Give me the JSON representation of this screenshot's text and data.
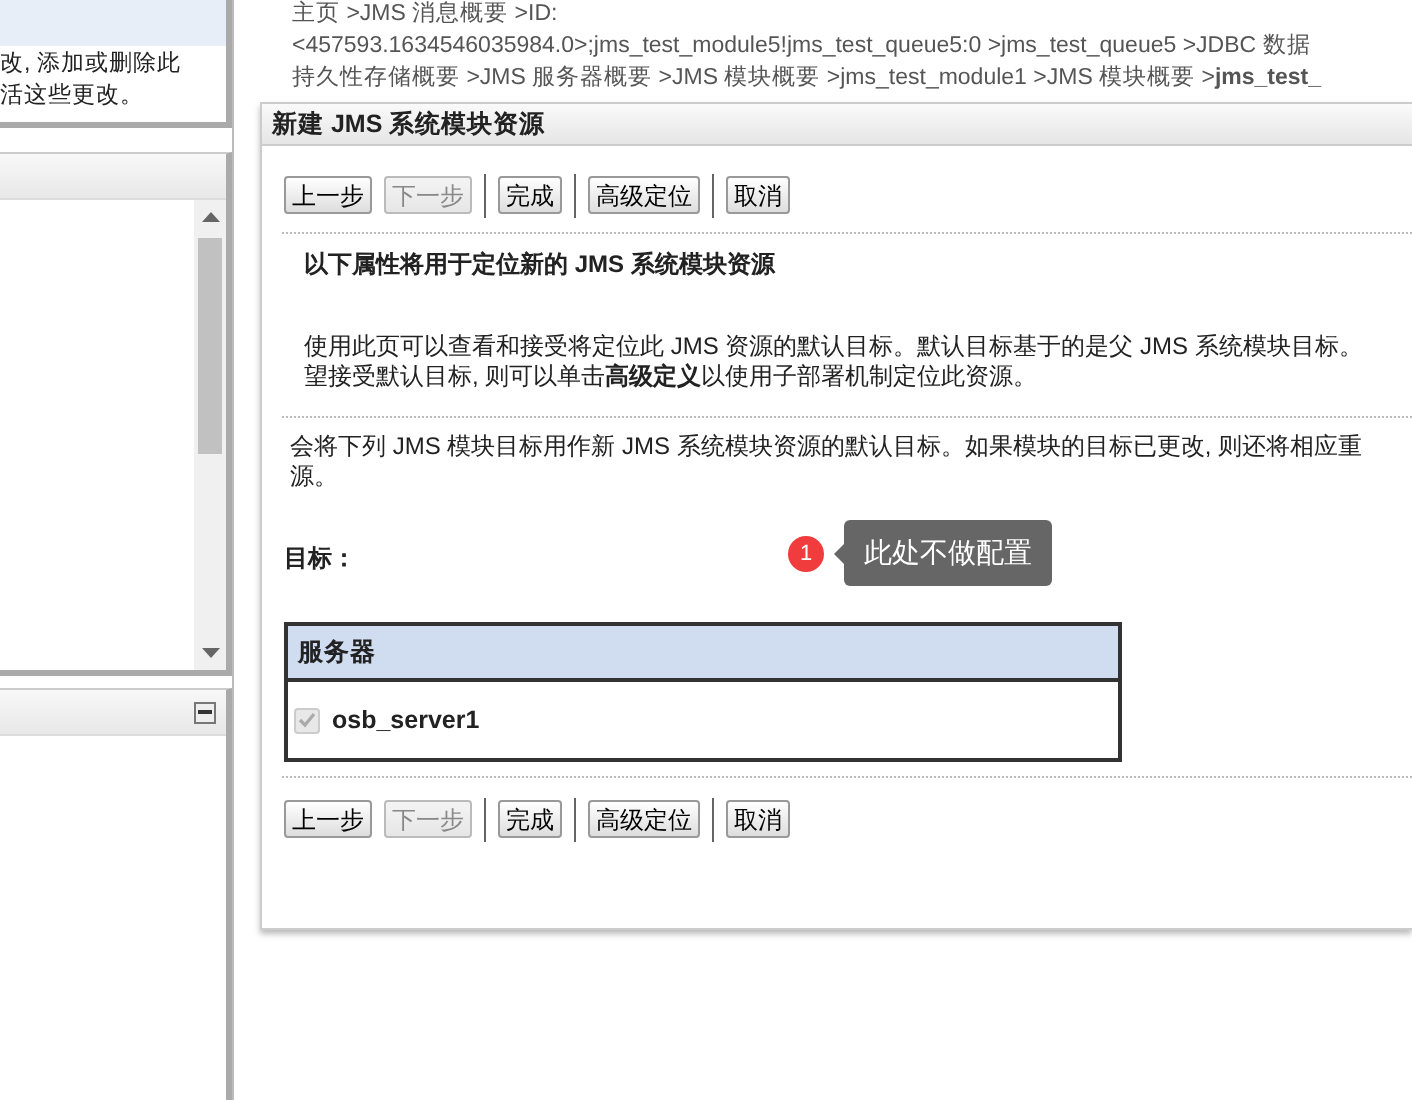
{
  "sidebar": {
    "change_center_lines": [
      "改, 添加或删除此",
      "活这些更改。"
    ],
    "panels": [
      {
        "kind": "scroll"
      },
      {
        "kind": "collapsible",
        "collapsed": false
      }
    ]
  },
  "breadcrumb": {
    "lines": [
      "主页 >JMS 消息概要 >ID:",
      "<457593.1634546035984.0>;jms_test_module5!jms_test_queue5:0 >jms_test_queue5 >JDBC 数据",
      "持久性存储概要 >JMS 服务器概要 >JMS 模块概要 >jms_test_module1 >JMS 模块概要 >**jms_test_**"
    ]
  },
  "panel": {
    "title": "新建 JMS 系统模块资源",
    "toolbar_top": [
      [
        {
          "label": "上一步",
          "disabled": false
        },
        {
          "label": "下一步",
          "disabled": true
        }
      ],
      [
        {
          "label": "完成",
          "disabled": false
        }
      ],
      [
        {
          "label": "高级定位",
          "disabled": false
        }
      ],
      [
        {
          "label": "取消",
          "disabled": false
        }
      ]
    ],
    "heading": "以下属性将用于定位新的 JMS 系统模块资源",
    "intro_lines": [
      "使用此页可以查看和接受将定位此 JMS 资源的默认目标。默认目标基于的是父 JMS 系统模块目标。",
      "望接受默认目标, 则可以单击**高级定义**以使用子部署机制定位此资源。"
    ],
    "note_lines": [
      "会将下列 JMS 模块目标用作新 JMS 系统模块资源的默认目标。如果模块的目标已更改, 则还将相应重",
      "源。"
    ],
    "targets_label": "目标：",
    "annotation": {
      "number": "1",
      "text": "此处不做配置"
    },
    "table": {
      "columns": [
        "服务器"
      ],
      "rows": [
        {
          "name": "osb_server1",
          "checked": true,
          "disabled": true
        }
      ]
    },
    "toolbar_bottom": [
      [
        {
          "label": "上一步",
          "disabled": false
        },
        {
          "label": "下一步",
          "disabled": true
        }
      ],
      [
        {
          "label": "完成",
          "disabled": false
        }
      ],
      [
        {
          "label": "高级定位",
          "disabled": false
        }
      ],
      [
        {
          "label": "取消",
          "disabled": false
        }
      ]
    ]
  }
}
